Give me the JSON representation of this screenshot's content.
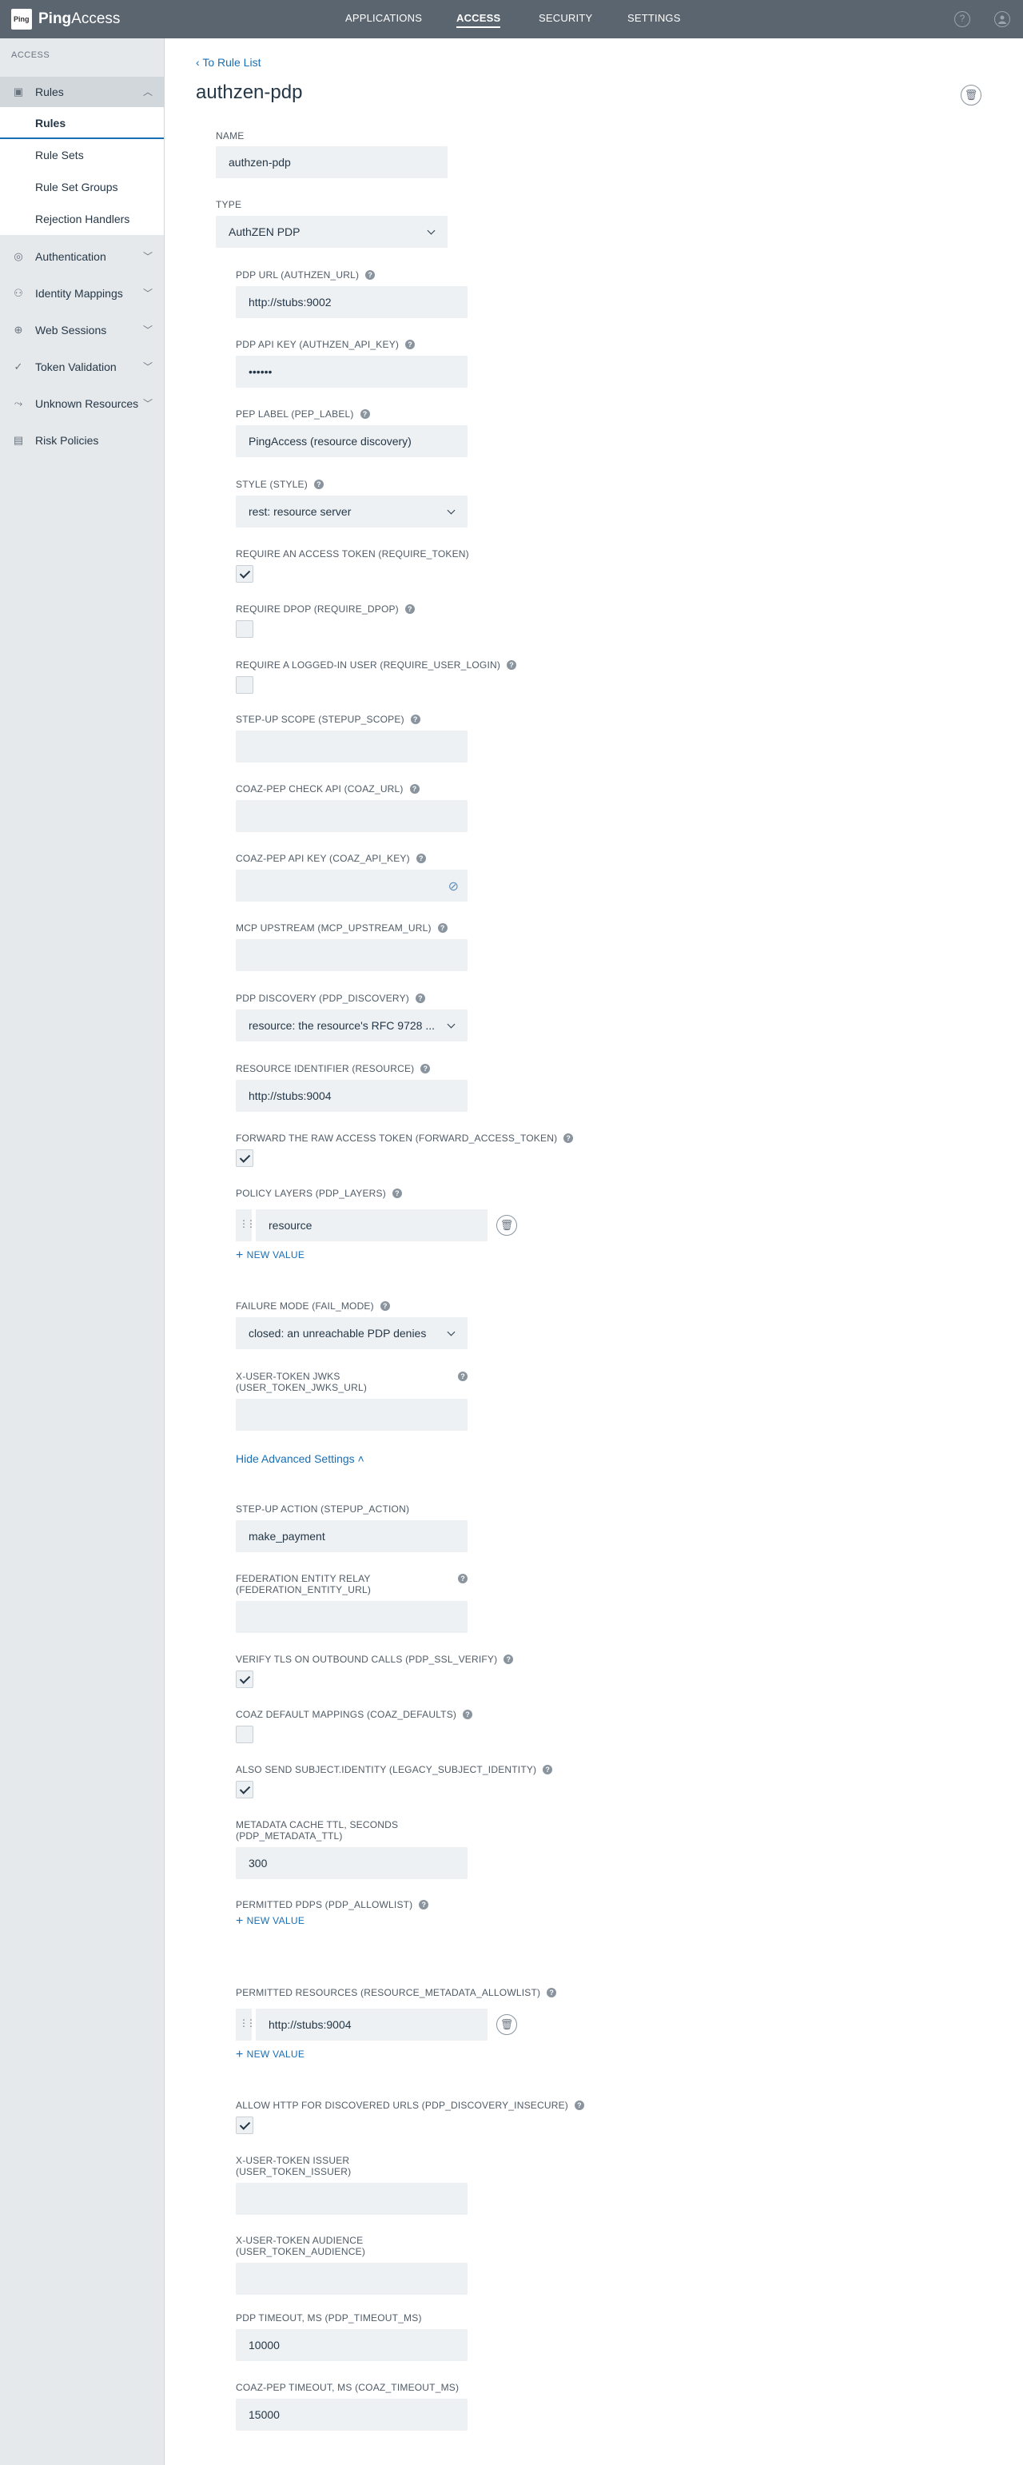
{
  "header": {
    "logo_text": "Ping",
    "brand_bold": "Ping",
    "brand_rest": "Access",
    "nav": [
      "APPLICATIONS",
      "ACCESS",
      "SECURITY",
      "SETTINGS"
    ],
    "active_nav": "ACCESS",
    "help_icon": "?",
    "user_icon": "user-icon"
  },
  "sidebar": {
    "heading": "ACCESS",
    "items": [
      {
        "label": "Rules",
        "icon": "rules-icon",
        "expanded": true
      },
      {
        "label": "Authentication",
        "icon": "authentication-icon"
      },
      {
        "label": "Identity Mappings",
        "icon": "identity-mappings-icon"
      },
      {
        "label": "Web Sessions",
        "icon": "globe-icon"
      },
      {
        "label": "Token Validation",
        "icon": "checkmark-icon"
      },
      {
        "label": "Unknown Resources",
        "icon": "route-icon"
      },
      {
        "label": "Risk Policies",
        "icon": "risk-policies-icon"
      }
    ],
    "sub_items": [
      "Rules",
      "Rule Sets",
      "Rule Set Groups",
      "Rejection Handlers"
    ],
    "active_sub": "Rules"
  },
  "page": {
    "back_link": "To Rule List",
    "title": "authzen-pdp",
    "name_label": "NAME",
    "name_value": "authzen-pdp",
    "type_label": "TYPE",
    "type_value": "AuthZEN PDP",
    "add_new": "NEW VALUE",
    "hide_advanced": "Hide Advanced Settings"
  },
  "fields": {
    "pdp_url": {
      "label": "PDP URL (AUTHZEN_URL)",
      "value": "http://stubs:9002"
    },
    "pdp_api_key": {
      "label": "PDP API KEY (AUTHZEN_API_KEY)",
      "value": "••••••"
    },
    "pep_label": {
      "label": "PEP LABEL (PEP_LABEL)",
      "value": "PingAccess (resource discovery)"
    },
    "style": {
      "label": "STYLE (STYLE)",
      "value": "rest: resource server"
    },
    "require_token": {
      "label": "REQUIRE AN ACCESS TOKEN (REQUIRE_TOKEN)",
      "checked": true
    },
    "require_dpop": {
      "label": "REQUIRE DPOP (REQUIRE_DPOP)",
      "checked": false
    },
    "require_user_login": {
      "label": "REQUIRE A LOGGED-IN USER (REQUIRE_USER_LOGIN)",
      "checked": false
    },
    "stepup_scope": {
      "label": "STEP-UP SCOPE (STEPUP_SCOPE)",
      "value": ""
    },
    "coaz_url": {
      "label": "COAZ-PEP CHECK API (COAZ_URL)",
      "value": ""
    },
    "coaz_api_key": {
      "label": "COAZ-PEP API KEY (COAZ_API_KEY)",
      "value": ""
    },
    "mcp_upstream": {
      "label": "MCP UPSTREAM (MCP_UPSTREAM_URL)",
      "value": ""
    },
    "pdp_discovery": {
      "label": "PDP DISCOVERY (PDP_DISCOVERY)",
      "value": "resource: the resource's RFC 9728 ..."
    },
    "resource": {
      "label": "RESOURCE IDENTIFIER (RESOURCE)",
      "value": "http://stubs:9004"
    },
    "forward_token": {
      "label": "FORWARD THE RAW ACCESS TOKEN (FORWARD_ACCESS_TOKEN)",
      "checked": true
    },
    "pdp_layers": {
      "label": "POLICY LAYERS (PDP_LAYERS)",
      "values": [
        "resource"
      ]
    },
    "fail_mode": {
      "label": "FAILURE MODE (FAIL_MODE)",
      "value": "closed: an unreachable PDP denies"
    },
    "user_token_jwks": {
      "label_line1": "X-USER-TOKEN JWKS",
      "label_line2": "(USER_TOKEN_JWKS_URL)",
      "value": ""
    },
    "stepup_action": {
      "label": "STEP-UP ACTION (STEPUP_ACTION)",
      "value": "make_payment"
    },
    "federation_relay": {
      "label_line1": "FEDERATION ENTITY RELAY",
      "label_line2": "(FEDERATION_ENTITY_URL)",
      "value": ""
    },
    "pdp_ssl_verify": {
      "label": "VERIFY TLS ON OUTBOUND CALLS (PDP_SSL_VERIFY)",
      "checked": true
    },
    "coaz_defaults": {
      "label": "COAZ DEFAULT MAPPINGS (COAZ_DEFAULTS)",
      "checked": false
    },
    "legacy_subject": {
      "label": "ALSO SEND SUBJECT.IDENTITY (LEGACY_SUBJECT_IDENTITY)",
      "checked": true
    },
    "metadata_ttl": {
      "label_line1": "METADATA CACHE TTL, SECONDS",
      "label_line2": "(PDP_METADATA_TTL)",
      "value": "300"
    },
    "pdp_allowlist": {
      "label": "PERMITTED PDPS (PDP_ALLOWLIST)",
      "values": []
    },
    "resource_allowlist": {
      "label": "PERMITTED RESOURCES (RESOURCE_METADATA_ALLOWLIST)",
      "values": [
        "http://stubs:9004"
      ]
    },
    "discovery_insecure": {
      "label": "ALLOW HTTP FOR DISCOVERED URLS (PDP_DISCOVERY_INSECURE)",
      "checked": true
    },
    "user_token_issuer": {
      "label_line1": "X-USER-TOKEN ISSUER",
      "label_line2": "(USER_TOKEN_ISSUER)",
      "value": ""
    },
    "user_token_audience": {
      "label_line1": "X-USER-TOKEN AUDIENCE",
      "label_line2": "(USER_TOKEN_AUDIENCE)",
      "value": ""
    },
    "pdp_timeout": {
      "label": "PDP TIMEOUT, MS (PDP_TIMEOUT_MS)",
      "value": "10000"
    },
    "coaz_timeout": {
      "label": "COAZ-PEP TIMEOUT, MS (COAZ_TIMEOUT_MS)",
      "value": "15000"
    }
  }
}
